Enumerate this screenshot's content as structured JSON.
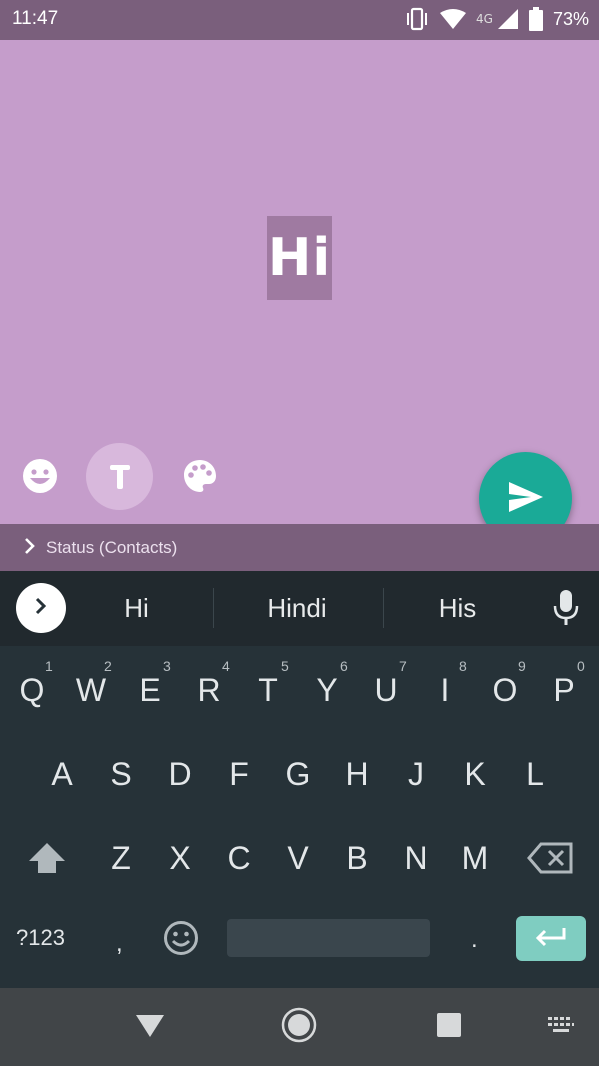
{
  "status_bar": {
    "time": "11:47",
    "network": "4G",
    "battery": "73%",
    "icons": [
      "vibrate-icon",
      "wifi-icon",
      "signal-icon",
      "battery-icon"
    ]
  },
  "composer": {
    "status_text": "Hi",
    "background_color": "#c59dcb",
    "tools": [
      "emoji-icon",
      "text-style-icon",
      "palette-icon"
    ],
    "send_icon": "send-icon"
  },
  "audience": {
    "label": "Status (Contacts)"
  },
  "suggestions": {
    "items": [
      "Hi",
      "Hindi",
      "His"
    ],
    "expand_icon": "chevron-right-icon",
    "mic_icon": "mic-icon"
  },
  "keyboard": {
    "row1": [
      "Q",
      "W",
      "E",
      "R",
      "T",
      "Y",
      "U",
      "I",
      "O",
      "P"
    ],
    "row1_hints": [
      "1",
      "2",
      "3",
      "4",
      "5",
      "6",
      "7",
      "8",
      "9",
      "0"
    ],
    "row2": [
      "A",
      "S",
      "D",
      "F",
      "G",
      "H",
      "J",
      "K",
      "L"
    ],
    "row3": [
      "Z",
      "X",
      "C",
      "V",
      "B",
      "N",
      "M"
    ],
    "symbols_label": "?123",
    "comma": ",",
    "period": ".",
    "accent_color": "#7fcdc1"
  },
  "navbar": {
    "icons": [
      "back-icon",
      "home-icon",
      "recents-icon",
      "keyboard-switch-icon"
    ]
  }
}
